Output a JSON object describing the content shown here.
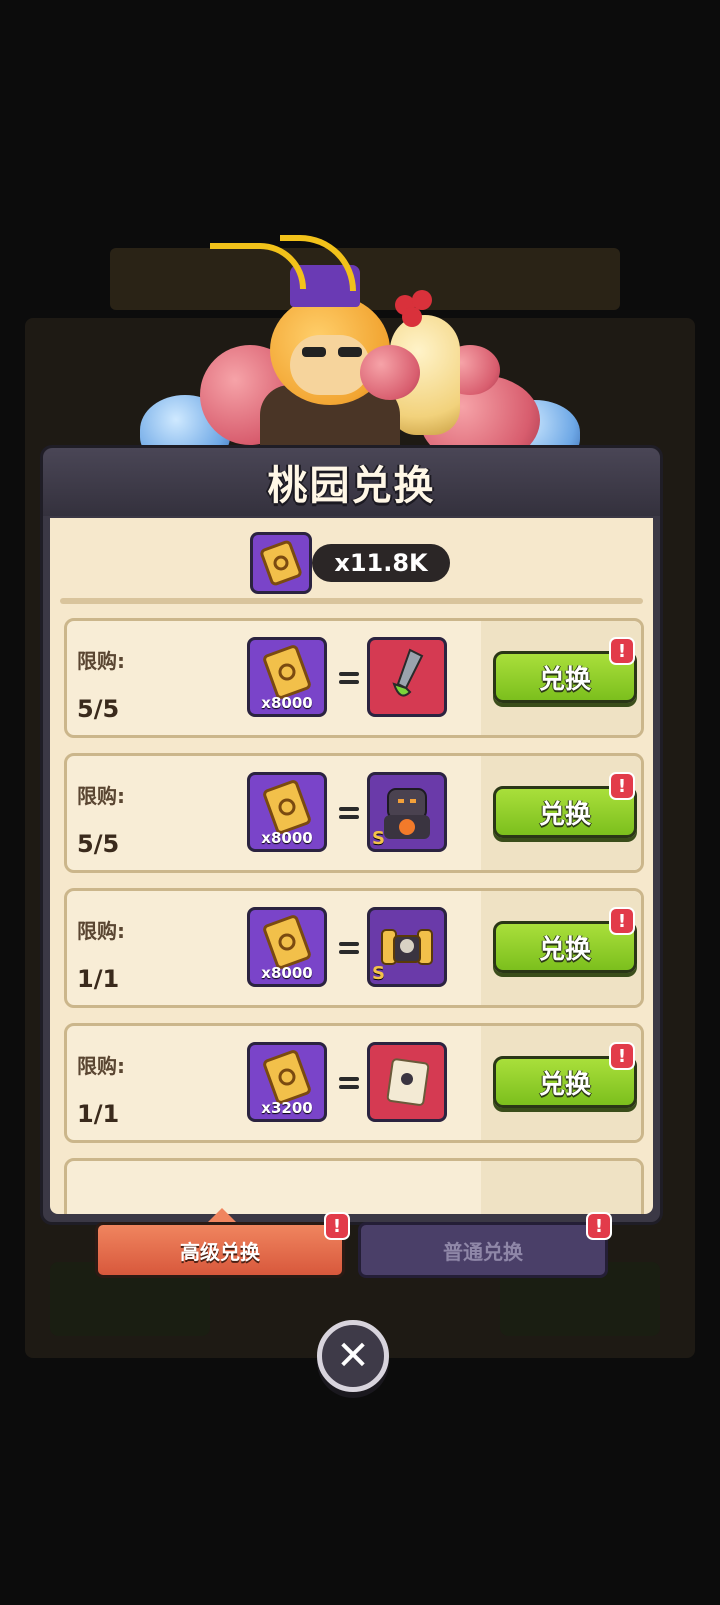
{
  "header": {
    "title": "桃园兑换"
  },
  "currency": {
    "amount": "x11.8K",
    "icon": "golden-scroll-icon"
  },
  "rows": [
    {
      "limit_label": "限购:",
      "limit_value": "5/5",
      "cost": "x8000",
      "reward_icon": "green-dagger-icon",
      "reward_grade": "",
      "button_label": "兑换",
      "badge": "!"
    },
    {
      "limit_label": "限购:",
      "limit_value": "5/5",
      "cost": "x8000",
      "reward_icon": "lava-golem-icon",
      "reward_grade": "S",
      "button_label": "兑换",
      "badge": "!"
    },
    {
      "limit_label": "限购:",
      "limit_value": "1/1",
      "cost": "x8000",
      "reward_icon": "golden-armor-icon",
      "reward_grade": "S",
      "button_label": "兑换",
      "badge": "!"
    },
    {
      "limit_label": "限购:",
      "limit_value": "1/1",
      "cost": "x3200",
      "reward_icon": "parchment-scroll-icon",
      "reward_grade": "",
      "button_label": "兑换",
      "badge": "!"
    }
  ],
  "tabs": [
    {
      "label": "高级兑换",
      "active": true,
      "badge": "!"
    },
    {
      "label": "普通兑换",
      "active": false,
      "badge": "!"
    }
  ],
  "close_icon": "close-icon",
  "colors": {
    "accent_green": "#8fd02a",
    "accent_orange": "#e76d4b",
    "panel_cream": "#f6e8cc",
    "badge_red": "#e23b4a"
  }
}
